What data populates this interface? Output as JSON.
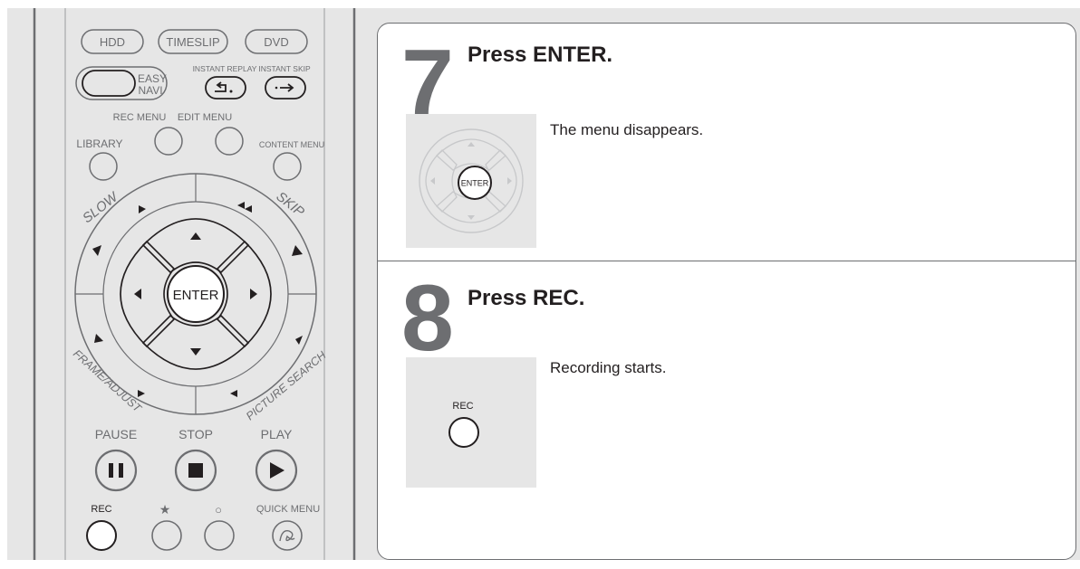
{
  "remote": {
    "buttons": {
      "hdd": "HDD",
      "timeslip": "TIMESLIP",
      "dvd": "DVD",
      "easy_navi_line1": "EASY",
      "easy_navi_line2": "NAVI",
      "instant_replay": "INSTANT REPLAY",
      "instant_skip": "INSTANT SKIP",
      "rec_menu": "REC MENU",
      "edit_menu": "EDIT MENU",
      "library": "LIBRARY",
      "content_menu": "CONTENT MENU",
      "slow": "SLOW",
      "skip": "SKIP",
      "enter": "ENTER",
      "frame_adjust": "FRAME/ADJUST",
      "picture_search": "PICTURE SEARCH",
      "pause": "PAUSE",
      "stop": "STOP",
      "play": "PLAY",
      "rec": "REC",
      "star": "★",
      "circle": "○",
      "quick_menu": "QUICK MENU"
    }
  },
  "steps": [
    {
      "number": "7",
      "title": "Press ENTER.",
      "description": "The menu disappears.",
      "image_button_label": "ENTER"
    },
    {
      "number": "8",
      "title": "Press REC.",
      "description": "Recording starts.",
      "image_button_label": "REC"
    }
  ]
}
